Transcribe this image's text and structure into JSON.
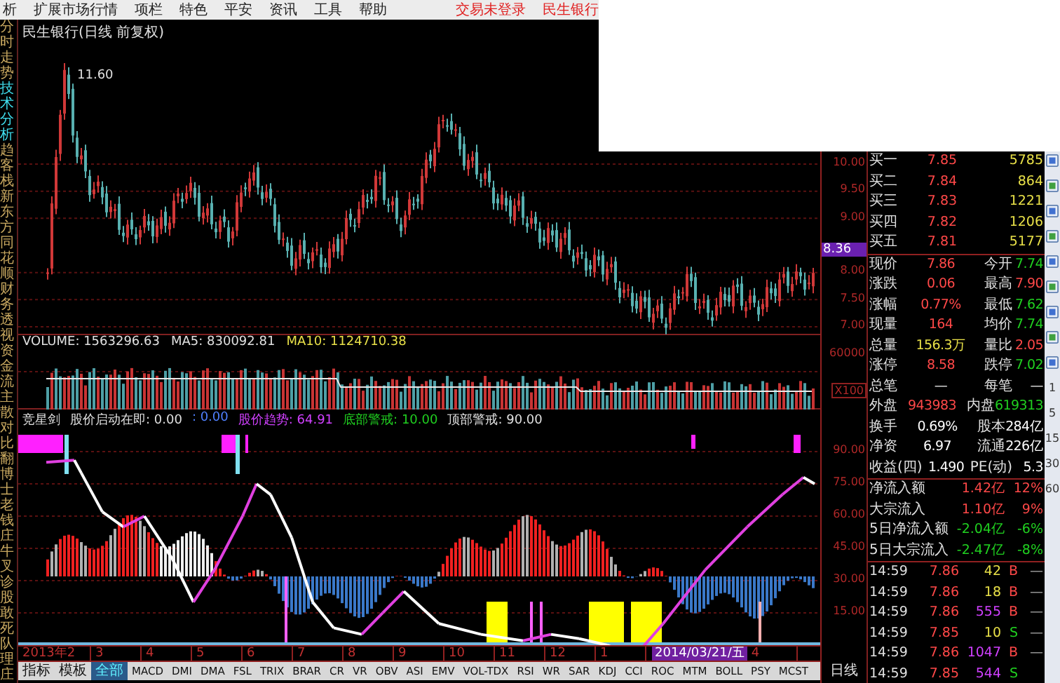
{
  "menu": {
    "items": [
      "析",
      "扩展市场行情",
      "项栏",
      "特色",
      "平安",
      "资讯",
      "工具",
      "帮助"
    ],
    "status": [
      "交易未登录",
      "民生银行"
    ]
  },
  "side_tabs": [
    {
      "label": "分时走势",
      "selected": false
    },
    {
      "label": "技术分析",
      "selected": true
    },
    {
      "label": "趋客栈",
      "selected": false
    },
    {
      "label": "新东方",
      "selected": false
    },
    {
      "label": "同花顺",
      "selected": false
    },
    {
      "label": "财务透视",
      "selected": false
    },
    {
      "label": "资金流",
      "selected": false
    },
    {
      "label": "主散对比",
      "selected": false
    },
    {
      "label": "翻博士",
      "selected": false
    },
    {
      "label": "老钱庄",
      "selected": false
    },
    {
      "label": "牛叉诊股",
      "selected": false
    },
    {
      "label": "敢死队",
      "selected": false
    },
    {
      "label": "理庄",
      "selected": false
    }
  ],
  "main_chart": {
    "title": "民生银行(日线 前复权)",
    "peak_label": "11.60",
    "price_ticks": [
      "10.00",
      "9.50",
      "9.00",
      "8.00",
      "7.50",
      "7.00"
    ],
    "current_price": "8.36"
  },
  "volume": {
    "readings": [
      {
        "text": "VOLUME: 1563296.63",
        "color": "#e0e0e0"
      },
      {
        "text": "MA5: 830092.81",
        "color": "#e0e0e0"
      },
      {
        "text": "MA10: 1124710.38",
        "color": "#e8e048"
      }
    ],
    "ticks": [
      "60000",
      "X100"
    ]
  },
  "indicator": {
    "name": "竞星剑",
    "readings": [
      {
        "text": "股价启动在即: 0.00",
        "color": "#e0e0e0"
      },
      {
        "text": ": 0.00",
        "color": "#5080ff"
      },
      {
        "text": "股价趋势: 64.91",
        "color": "#d040ff"
      },
      {
        "text": "底部警戒: 10.00",
        "color": "#20d020"
      },
      {
        "text": "顶部警戒: 90.00",
        "color": "#e0e0e0"
      }
    ],
    "ticks": [
      "90.00",
      "75.00",
      "60.00",
      "45.00",
      "30.00",
      "15.00"
    ]
  },
  "timeline": {
    "months": [
      "2013年2",
      "3",
      "4",
      "5",
      "6",
      "7",
      "8",
      "9",
      "10",
      "11",
      "12",
      "1"
    ],
    "cursor": "2014/03/21/五",
    "after": [
      "4"
    ]
  },
  "period": "日线",
  "bottom_tabs": [
    {
      "label": "指标",
      "selected": false
    },
    {
      "label": "模板",
      "selected": false
    },
    {
      "label": "全部",
      "selected": true
    },
    {
      "label": "MACD",
      "selected": false
    },
    {
      "label": "DMI",
      "selected": false
    },
    {
      "label": "DMA",
      "selected": false
    },
    {
      "label": "FSL",
      "selected": false
    },
    {
      "label": "TRIX",
      "selected": false
    },
    {
      "label": "BRAR",
      "selected": false
    },
    {
      "label": "CR",
      "selected": false
    },
    {
      "label": "VR",
      "selected": false
    },
    {
      "label": "OBV",
      "selected": false
    },
    {
      "label": "ASI",
      "selected": false
    },
    {
      "label": "EMV",
      "selected": false
    },
    {
      "label": "VOL-TDX",
      "selected": false
    },
    {
      "label": "RSI",
      "selected": false
    },
    {
      "label": "WR",
      "selected": false
    },
    {
      "label": "SAR",
      "selected": false
    },
    {
      "label": "KDJ",
      "selected": false
    },
    {
      "label": "CCI",
      "selected": false
    },
    {
      "label": "ROC",
      "selected": false
    },
    {
      "label": "MTM",
      "selected": false
    },
    {
      "label": "BOLL",
      "selected": false
    },
    {
      "label": "PSY",
      "selected": false
    },
    {
      "label": "MCST",
      "selected": false
    }
  ],
  "quote": {
    "bids": [
      {
        "label": "买一",
        "price": "7.85",
        "volume": "5785"
      },
      {
        "label": "买二",
        "price": "7.84",
        "volume": "864"
      },
      {
        "label": "买三",
        "price": "7.83",
        "volume": "1221"
      },
      {
        "label": "买四",
        "price": "7.82",
        "volume": "1206"
      },
      {
        "label": "买五",
        "price": "7.81",
        "volume": "5177"
      }
    ],
    "stats": [
      {
        "label": "现价",
        "value": "7.86",
        "color": "#ff4848"
      },
      {
        "label": "今开",
        "value": "7.74",
        "color": "#20d020"
      },
      {
        "label": "涨跌",
        "value": "0.06",
        "color": "#ff4848"
      },
      {
        "label": "最高",
        "value": "7.90",
        "color": "#ff4848"
      },
      {
        "label": "涨幅",
        "value": "0.77%",
        "color": "#ff4848"
      },
      {
        "label": "最低",
        "value": "7.62",
        "color": "#20d020"
      },
      {
        "label": "现量",
        "value": "164",
        "color": "#ff4848"
      },
      {
        "label": "均价",
        "value": "7.74",
        "color": "#20d020"
      },
      {
        "label": "总量",
        "value": "156.3万",
        "color": "#e8e048"
      },
      {
        "label": "量比",
        "value": "2.05",
        "color": "#ff4848"
      },
      {
        "label": "涨停",
        "value": "8.58",
        "color": "#ff4848"
      },
      {
        "label": "跌停",
        "value": "7.02",
        "color": "#20d020"
      },
      {
        "label": "总笔",
        "value": "—"
      },
      {
        "label": "每笔",
        "value": "—"
      },
      {
        "label": "外盘",
        "value": "943983",
        "color": "#ff4848"
      },
      {
        "label": "内盘",
        "value": "619313",
        "color": "#20d020"
      },
      {
        "label": "换手",
        "value": "0.69%",
        "color": "#ffffff"
      },
      {
        "label": "股本",
        "value": "284亿",
        "color": "#ffffff"
      },
      {
        "label": "净资",
        "value": "6.97",
        "color": "#ffffff"
      },
      {
        "label": "流通",
        "value": "226亿",
        "color": "#ffffff"
      },
      {
        "label": "收益(四)",
        "value": "1.490",
        "color": "#ffffff"
      },
      {
        "label": "PE(动)",
        "value": "5.3",
        "color": "#ffffff"
      }
    ],
    "flows": [
      {
        "label": "净流入额",
        "amount": "1.42亿",
        "share": "12%",
        "color": "#ff4848"
      },
      {
        "label": "大宗流入",
        "amount": "1.10亿",
        "share": "9%",
        "color": "#ff4848"
      },
      {
        "label": "5日净流入额",
        "amount": "-2.04亿",
        "share": "-6%",
        "color": "#20d020"
      },
      {
        "label": "5日大宗流入",
        "amount": "-2.47亿",
        "share": "-8%",
        "color": "#20d020"
      }
    ],
    "trades": [
      {
        "time": "14:59",
        "price": "7.86",
        "volume": "42",
        "side": "B",
        "large": false,
        "mark": "—"
      },
      {
        "time": "14:59",
        "price": "7.86",
        "volume": "18",
        "side": "B",
        "large": false,
        "mark": "—"
      },
      {
        "time": "14:59",
        "price": "7.86",
        "volume": "555",
        "side": "B",
        "large": true,
        "mark": "—"
      },
      {
        "time": "14:59",
        "price": "7.85",
        "volume": "10",
        "side": "S",
        "large": false,
        "mark": "—"
      },
      {
        "time": "14:59",
        "price": "7.86",
        "volume": "1047",
        "side": "B",
        "large": true,
        "mark": "—"
      },
      {
        "time": "14:59",
        "price": "7.85",
        "volume": "544",
        "side": "S",
        "large": true
      }
    ]
  },
  "period_buttons": [
    "1",
    "5",
    "15",
    "30",
    "60"
  ]
}
